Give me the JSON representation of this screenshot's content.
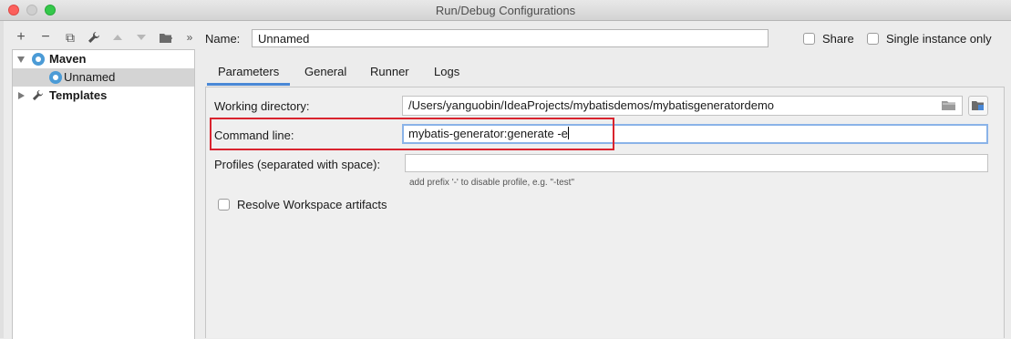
{
  "window": {
    "title": "Run/Debug Configurations"
  },
  "toolbar": {
    "add": "+",
    "remove": "−",
    "copy": "⧉",
    "more": "»"
  },
  "tree": {
    "items": [
      {
        "label": "Maven"
      },
      {
        "label": "Unnamed"
      },
      {
        "label": "Templates"
      }
    ]
  },
  "header": {
    "name_label": "Name:",
    "name_value": "Unnamed",
    "share_label": "Share",
    "single_instance_label": "Single instance only"
  },
  "tabs": [
    {
      "label": "Parameters"
    },
    {
      "label": "General"
    },
    {
      "label": "Runner"
    },
    {
      "label": "Logs"
    }
  ],
  "form": {
    "working_directory_label": "Working directory:",
    "working_directory_value": "/Users/yanguobin/IdeaProjects/mybatisdemos/mybatisgeneratordemo",
    "command_line_label": "Command line:",
    "command_line_value": "mybatis-generator:generate -e",
    "profiles_label": "Profiles (separated with space):",
    "profiles_value": "",
    "profiles_hint": "add prefix '-' to disable profile, e.g. \"-test\"",
    "resolve_label": "Resolve Workspace artifacts"
  },
  "colors": {
    "accent": "#4a88d6",
    "highlight_box": "#d9232e",
    "maven_icon": "#4b9bd6"
  }
}
